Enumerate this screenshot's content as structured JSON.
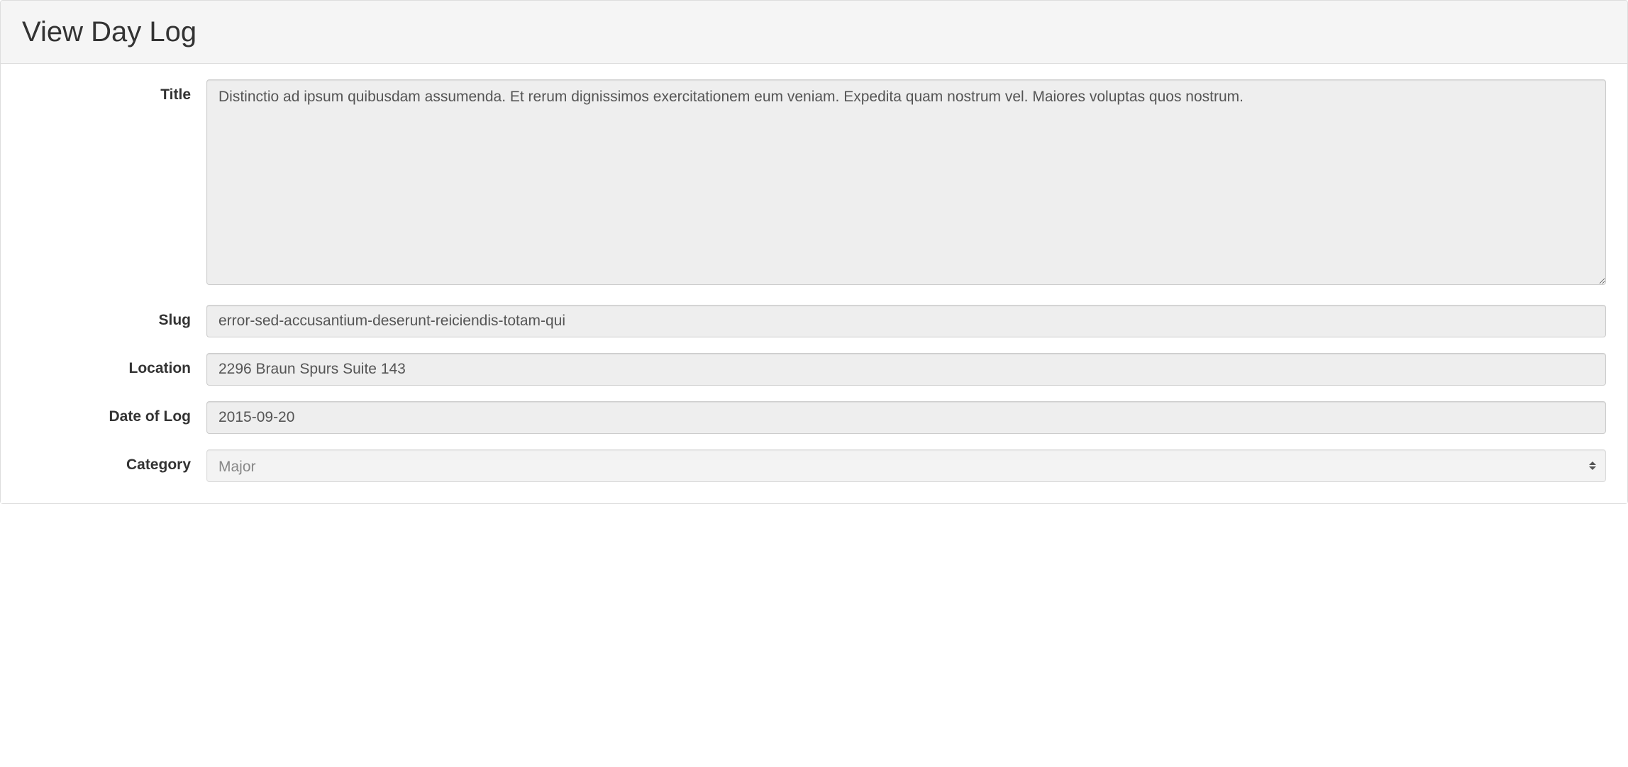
{
  "panel": {
    "title": "View Day Log"
  },
  "form": {
    "title": {
      "label": "Title",
      "value": "Distinctio ad ipsum quibusdam assumenda. Et rerum dignissimos exercitationem eum veniam. Expedita quam nostrum vel. Maiores voluptas quos nostrum."
    },
    "slug": {
      "label": "Slug",
      "value": "error-sed-accusantium-deserunt-reiciendis-totam-qui"
    },
    "location": {
      "label": "Location",
      "value": "2296 Braun Spurs Suite 143"
    },
    "date_of_log": {
      "label": "Date of Log",
      "value": "2015-09-20"
    },
    "category": {
      "label": "Category",
      "selected": "Major"
    }
  }
}
